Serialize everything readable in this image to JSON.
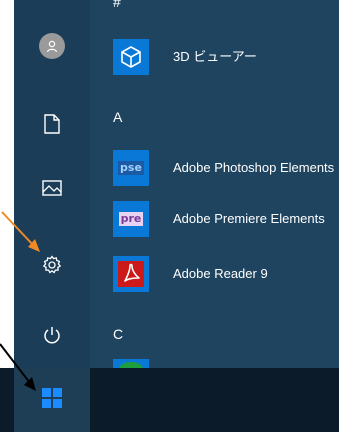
{
  "apps": {
    "hash_header": "#",
    "a_header": "A",
    "c_header": "C",
    "viewer_3d": "3D ビューアー",
    "photoshop_elements": "Adobe Photoshop Elements",
    "premiere_elements": "Adobe Premiere Elements",
    "adobe_reader": "Adobe Reader 9"
  },
  "tiles": {
    "photoshop": "pse",
    "premiere": "pre"
  },
  "colors": {
    "menu_background": "#1e4460",
    "sidebar_background": "#1b3d58",
    "taskbar_background": "#0b1b29",
    "accent_tile": "#0a78d7",
    "photoshop_tile": "#1c5aa6",
    "premiere_tile": "#7a3a9a",
    "reader_tile": "#cc1a1a",
    "annotation_arrow_orange": "#f08a24",
    "annotation_arrow_black": "#000000"
  },
  "icons": {
    "user": "user-avatar-icon",
    "documents": "document-icon",
    "pictures": "picture-icon",
    "settings": "gear-icon",
    "power": "power-icon",
    "start": "windows-logo-icon",
    "viewer_3d": "cube-icon",
    "reader": "acrobat-icon"
  }
}
